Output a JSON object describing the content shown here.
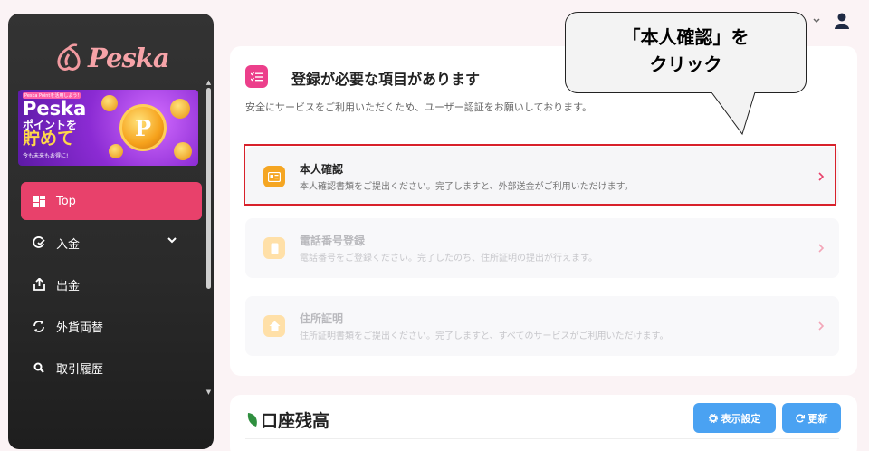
{
  "sidebar": {
    "logo_text": "Peska",
    "banner": {
      "small": "Peska Pointを活用しよう!",
      "line1": "Peska",
      "line2": "ポイントを",
      "line3": "貯めて",
      "line4": "今も未来もお得に!",
      "coin": "P"
    },
    "items": [
      {
        "label": "Top",
        "icon": "dashboard-icon",
        "active": true
      },
      {
        "label": "入金",
        "icon": "deposit-icon",
        "has_chevron": true
      },
      {
        "label": "出金",
        "icon": "withdraw-icon"
      },
      {
        "label": "外貨両替",
        "icon": "exchange-icon"
      },
      {
        "label": "取引履歴",
        "icon": "search-icon"
      }
    ]
  },
  "header": {
    "user_icon": "user-icon"
  },
  "registration": {
    "title": "登録が必要な項目があります",
    "subtitle": "安全にサービスをご利用いただくため、ユーザー認証をお願いしております。",
    "items": [
      {
        "title": "本人確認",
        "desc": "本人確認書類をご提出ください。完了しますと、外部送金がご利用いただけます。",
        "icon": "id-card-icon",
        "enabled": true
      },
      {
        "title": "電話番号登録",
        "desc": "電話番号をご登録ください。完了したのち、住所証明の提出が行えます。",
        "icon": "phone-icon",
        "enabled": false
      },
      {
        "title": "住所証明",
        "desc": "住所証明書類をご提出ください。完了しますと、すべてのサービスがご利用いただけます。",
        "icon": "home-icon",
        "enabled": false
      }
    ]
  },
  "callout": {
    "line1": "「本人確認」を",
    "line2": "クリック"
  },
  "balance": {
    "title": "口座残高",
    "display_settings_label": "表示設定",
    "refresh_label": "更新"
  },
  "colors": {
    "accent": "#e8416b",
    "brand_pink": "#ec3f8b",
    "button_blue": "#4aa2f2",
    "highlight_red": "#d8212b"
  }
}
